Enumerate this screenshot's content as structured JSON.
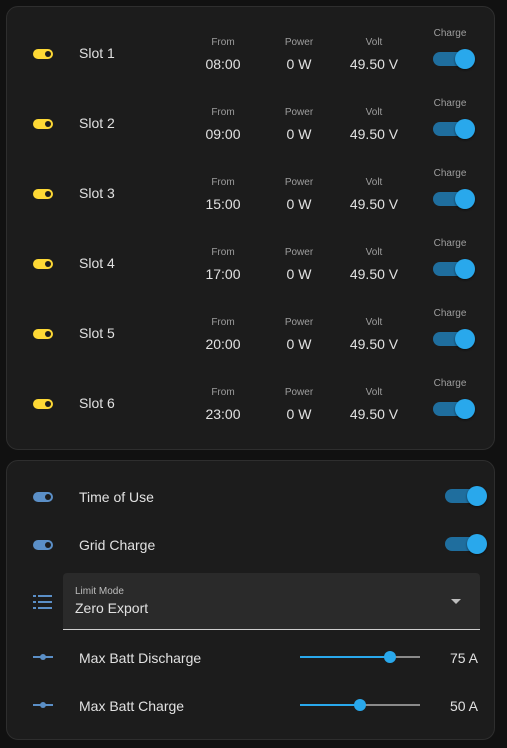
{
  "slots": [
    {
      "name": "Slot 1",
      "from": "08:00",
      "power": "0 W",
      "volt": "49.50 V",
      "charge_on": true
    },
    {
      "name": "Slot 2",
      "from": "09:00",
      "power": "0 W",
      "volt": "49.50 V",
      "charge_on": true
    },
    {
      "name": "Slot 3",
      "from": "15:00",
      "power": "0 W",
      "volt": "49.50 V",
      "charge_on": true
    },
    {
      "name": "Slot 4",
      "from": "17:00",
      "power": "0 W",
      "volt": "49.50 V",
      "charge_on": true
    },
    {
      "name": "Slot 5",
      "from": "20:00",
      "power": "0 W",
      "volt": "49.50 V",
      "charge_on": true
    },
    {
      "name": "Slot 6",
      "from": "23:00",
      "power": "0 W",
      "volt": "49.50 V",
      "charge_on": true
    }
  ],
  "labels": {
    "from": "From",
    "power": "Power",
    "volt": "Volt",
    "charge": "Charge"
  },
  "settings": {
    "time_of_use": {
      "label": "Time of Use",
      "on": true
    },
    "grid_charge": {
      "label": "Grid Charge",
      "on": true
    },
    "limit_mode": {
      "label": "Limit Mode",
      "value": "Zero Export"
    },
    "max_batt_discharge": {
      "label": "Max Batt Discharge",
      "value_text": "75 A",
      "fraction": 0.75
    },
    "max_batt_charge": {
      "label": "Max Batt Charge",
      "value_text": "50 A",
      "fraction": 0.5
    }
  },
  "colors": {
    "accent": "#29a8ec",
    "slot_icon": "#fdd835",
    "setting_icon": "#5b8fc7"
  },
  "icons": {
    "slot": "toggle-switch-icon",
    "settings_toggle": "toggle-switch-icon",
    "limit_mode": "format-list-icon",
    "slider": "slider-icon",
    "dropdown": "menu-down-icon"
  }
}
